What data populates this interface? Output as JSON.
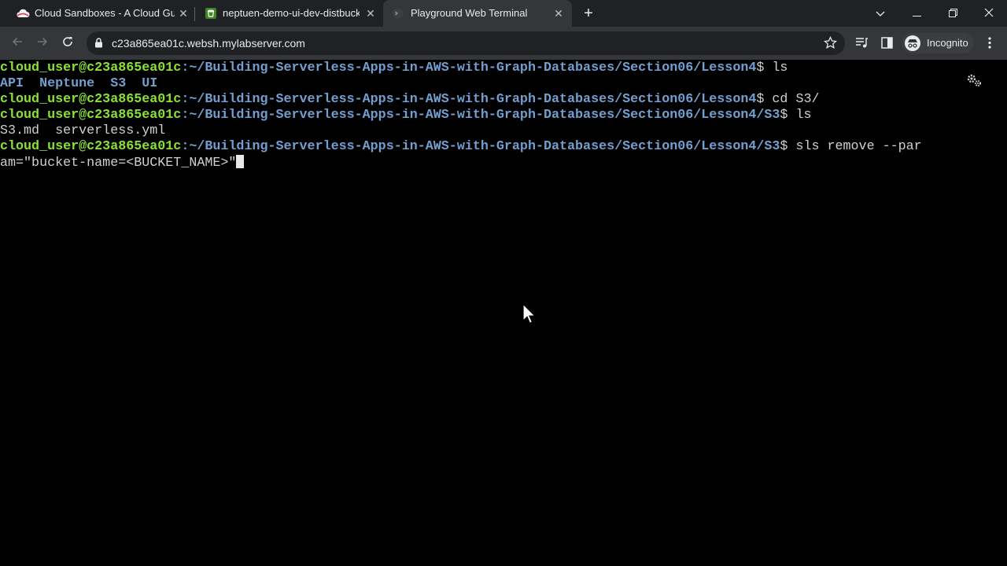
{
  "browser": {
    "tabs": [
      {
        "title": "Cloud Sandboxes - A Cloud Guru",
        "icon": "cloud-icon"
      },
      {
        "title": "neptuen-demo-ui-dev-distbucke",
        "icon": "s3-bucket-icon"
      },
      {
        "title": "Playground Web Terminal",
        "icon": "terminal-icon"
      }
    ],
    "url": "c23a865ea01c.websh.mylabserver.com",
    "profile_label": "Incognito"
  },
  "terminal": {
    "prompt_user": "cloud_user@c23a865ea01c",
    "prompt_path_lesson": ":~/Building-Serverless-Apps-in-AWS-with-Graph-Databases/Section06/Lesson4",
    "prompt_path_s3": ":~/Building-Serverless-Apps-in-AWS-with-Graph-Databases/Section06/Lesson4/S3",
    "prompt_symbol": "$ ",
    "cmd1": "ls",
    "ls1_dirs": [
      "API",
      "Neptune",
      "S3",
      "UI"
    ],
    "cmd2": "cd S3/",
    "cmd3": "ls",
    "ls2_output": "S3.md  serverless.yml",
    "cmd4_part1": "sls remove --par",
    "cmd4_part2": "am=\"bucket-name=<BUCKET_NAME>\""
  },
  "colors": {
    "prompt_user": "#8ae234",
    "prompt_path": "#729fcf",
    "terminal_bg": "#000000",
    "tabstrip_bg": "#202124",
    "toolbar_bg": "#35363a"
  }
}
